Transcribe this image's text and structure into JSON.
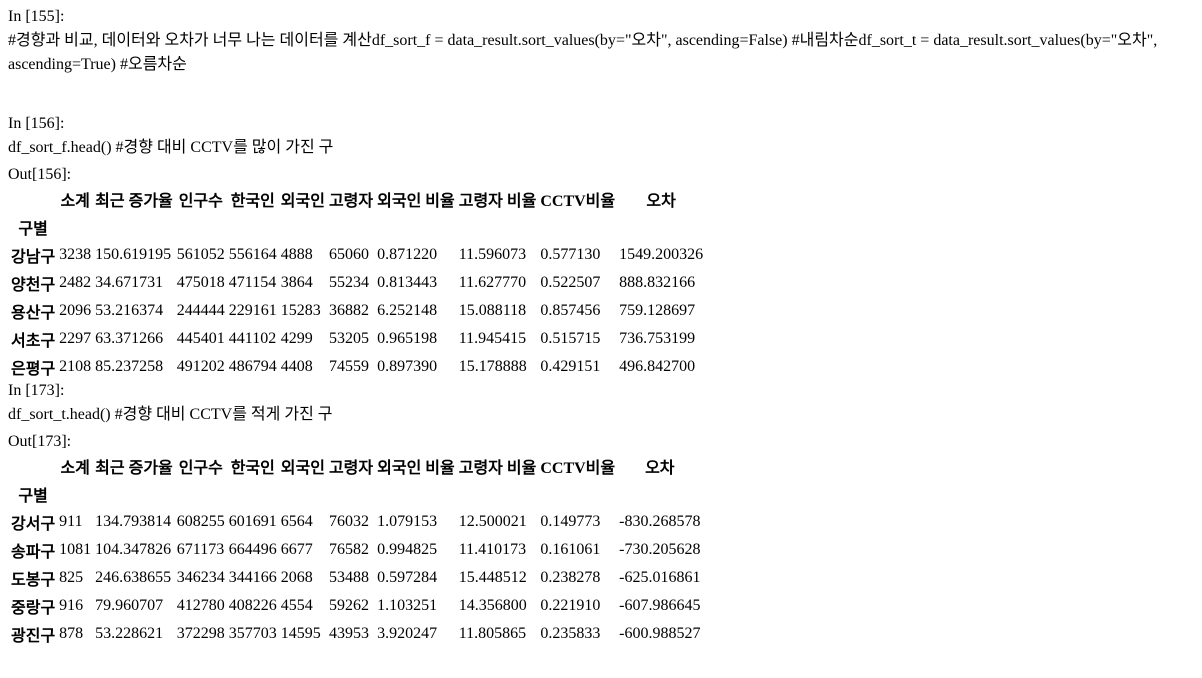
{
  "cells": [
    {
      "kind": "input",
      "prompt": "In [155]:",
      "lines": [
        [
          {
            "t": "com",
            "v": "#경향과 비교, 데이터와 오차가 너무 나는 데이터를 계산"
          }
        ],
        [],
        [
          {
            "t": "txt",
            "v": "df_sort_f "
          },
          {
            "t": "op",
            "v": "="
          },
          {
            "t": "txt",
            "v": " data_result.sort_values(by"
          },
          {
            "t": "op",
            "v": "="
          },
          {
            "t": "str",
            "v": "\"오차\""
          },
          {
            "t": "txt",
            "v": ", ascending"
          },
          {
            "t": "op",
            "v": "="
          },
          {
            "t": "kw",
            "v": "False"
          },
          {
            "t": "txt",
            "v": ") "
          },
          {
            "t": "com",
            "v": "#내림차순"
          }
        ],
        [
          {
            "t": "txt",
            "v": "df_sort_t "
          },
          {
            "t": "op",
            "v": "="
          },
          {
            "t": "txt",
            "v": " data_result.sort_values(by"
          },
          {
            "t": "op",
            "v": "="
          },
          {
            "t": "str",
            "v": "\"오차\""
          },
          {
            "t": "txt",
            "v": ", ascending"
          },
          {
            "t": "op",
            "v": "="
          },
          {
            "t": "kw",
            "v": "True"
          },
          {
            "t": "txt",
            "v": ") "
          },
          {
            "t": "com",
            "v": "#오름차순"
          }
        ]
      ]
    },
    {
      "kind": "input",
      "prompt": "In [156]:",
      "lines": [
        [
          {
            "t": "txt",
            "v": "df_sort_f.head() "
          },
          {
            "t": "com",
            "v": "#경향 대비 CCTV를 많이 가진 구"
          }
        ]
      ]
    },
    {
      "kind": "output",
      "prompt": "Out[156]:",
      "table": {
        "columns": [
          "소계",
          "최근 증가율",
          "인구수",
          "한국인",
          "외국인",
          "고령자",
          "외국인 비율",
          "고령자 비율",
          "CCTV비율",
          "오차"
        ],
        "index_name": "구별",
        "rows": [
          [
            "강남구",
            "3238",
            "150.619195",
            "561052",
            "556164",
            "4888",
            "65060",
            "0.871220",
            "11.596073",
            "0.577130",
            "1549.200326"
          ],
          [
            "양천구",
            "2482",
            "34.671731",
            "475018",
            "471154",
            "3864",
            "55234",
            "0.813443",
            "11.627770",
            "0.522507",
            "888.832166"
          ],
          [
            "용산구",
            "2096",
            "53.216374",
            "244444",
            "229161",
            "15283",
            "36882",
            "6.252148",
            "15.088118",
            "0.857456",
            "759.128697"
          ],
          [
            "서초구",
            "2297",
            "63.371266",
            "445401",
            "441102",
            "4299",
            "53205",
            "0.965198",
            "11.945415",
            "0.515715",
            "736.753199"
          ],
          [
            "은평구",
            "2108",
            "85.237258",
            "491202",
            "486794",
            "4408",
            "74559",
            "0.897390",
            "15.178888",
            "0.429151",
            "496.842700"
          ]
        ]
      }
    },
    {
      "kind": "input",
      "prompt": "In [173]:",
      "lines": [
        [
          {
            "t": "txt",
            "v": "df_sort_t.head() "
          },
          {
            "t": "com",
            "v": "#경향 대비 CCTV를 적게 가진 구"
          }
        ]
      ]
    },
    {
      "kind": "output",
      "prompt": "Out[173]:",
      "table": {
        "columns": [
          "소계",
          "최근 증가율",
          "인구수",
          "한국인",
          "외국인",
          "고령자",
          "외국인 비율",
          "고령자 비율",
          "CCTV비율",
          "오차"
        ],
        "index_name": "구별",
        "rows": [
          [
            "강서구",
            "911",
            "134.793814",
            "608255",
            "601691",
            "6564",
            "76032",
            "1.079153",
            "12.500021",
            "0.149773",
            "-830.268578"
          ],
          [
            "송파구",
            "1081",
            "104.347826",
            "671173",
            "664496",
            "6677",
            "76582",
            "0.994825",
            "11.410173",
            "0.161061",
            "-730.205628"
          ],
          [
            "도봉구",
            "825",
            "246.638655",
            "346234",
            "344166",
            "2068",
            "53488",
            "0.597284",
            "15.448512",
            "0.238278",
            "-625.016861"
          ],
          [
            "중랑구",
            "916",
            "79.960707",
            "412780",
            "408226",
            "4554",
            "59262",
            "1.103251",
            "14.356800",
            "0.221910",
            "-607.986645"
          ],
          [
            "광진구",
            "878",
            "53.228621",
            "372298",
            "357703",
            "14595",
            "43953",
            "3.920247",
            "11.805865",
            "0.235833",
            "-600.988527"
          ]
        ]
      }
    }
  ]
}
